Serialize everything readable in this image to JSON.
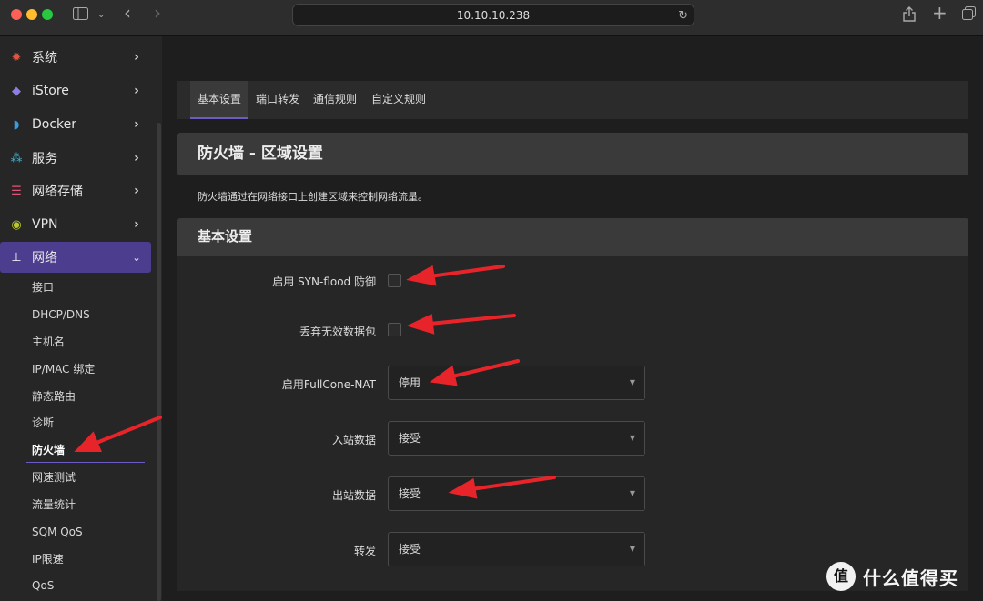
{
  "browser": {
    "url": "10.10.10.238"
  },
  "colors": {
    "accent": "#6a5cc4",
    "active_bg": "#4c3d8f",
    "annotation": "#e8242b"
  },
  "sidebar": {
    "items": [
      {
        "label": "系统",
        "icon": "gear-icon"
      },
      {
        "label": "iStore",
        "icon": "cube-icon"
      },
      {
        "label": "Docker",
        "icon": "docker-whale-icon"
      },
      {
        "label": "服务",
        "icon": "services-icon"
      },
      {
        "label": "网络存储",
        "icon": "database-icon"
      },
      {
        "label": "VPN",
        "icon": "vpn-globe-icon"
      },
      {
        "label": "网络",
        "icon": "network-tree-icon"
      }
    ],
    "subitems": [
      "接口",
      "DHCP/DNS",
      "主机名",
      "IP/MAC 绑定",
      "静态路由",
      "诊断",
      "防火墙",
      "网速测试",
      "流量统计",
      "SQM QoS",
      "IP限速",
      "QoS"
    ],
    "current_sub": "防火墙"
  },
  "tabs": [
    "基本设置",
    "端口转发",
    "通信规则",
    "自定义规则"
  ],
  "page": {
    "title": "防火墙 - 区域设置",
    "description": "防火墙通过在网络接口上创建区域来控制网络流量。"
  },
  "section": {
    "title": "基本设置",
    "fields": {
      "syn_flood": {
        "label": "启用 SYN-flood 防御"
      },
      "drop_invalid": {
        "label": "丢弃无效数据包"
      },
      "fullcone": {
        "label": "启用FullCone-NAT",
        "value": "停用"
      },
      "input": {
        "label": "入站数据",
        "value": "接受"
      },
      "output": {
        "label": "出站数据",
        "value": "接受"
      },
      "forward": {
        "label": "转发",
        "value": "接受"
      }
    }
  },
  "watermark": {
    "logo": "值",
    "text": "什么值得买"
  }
}
